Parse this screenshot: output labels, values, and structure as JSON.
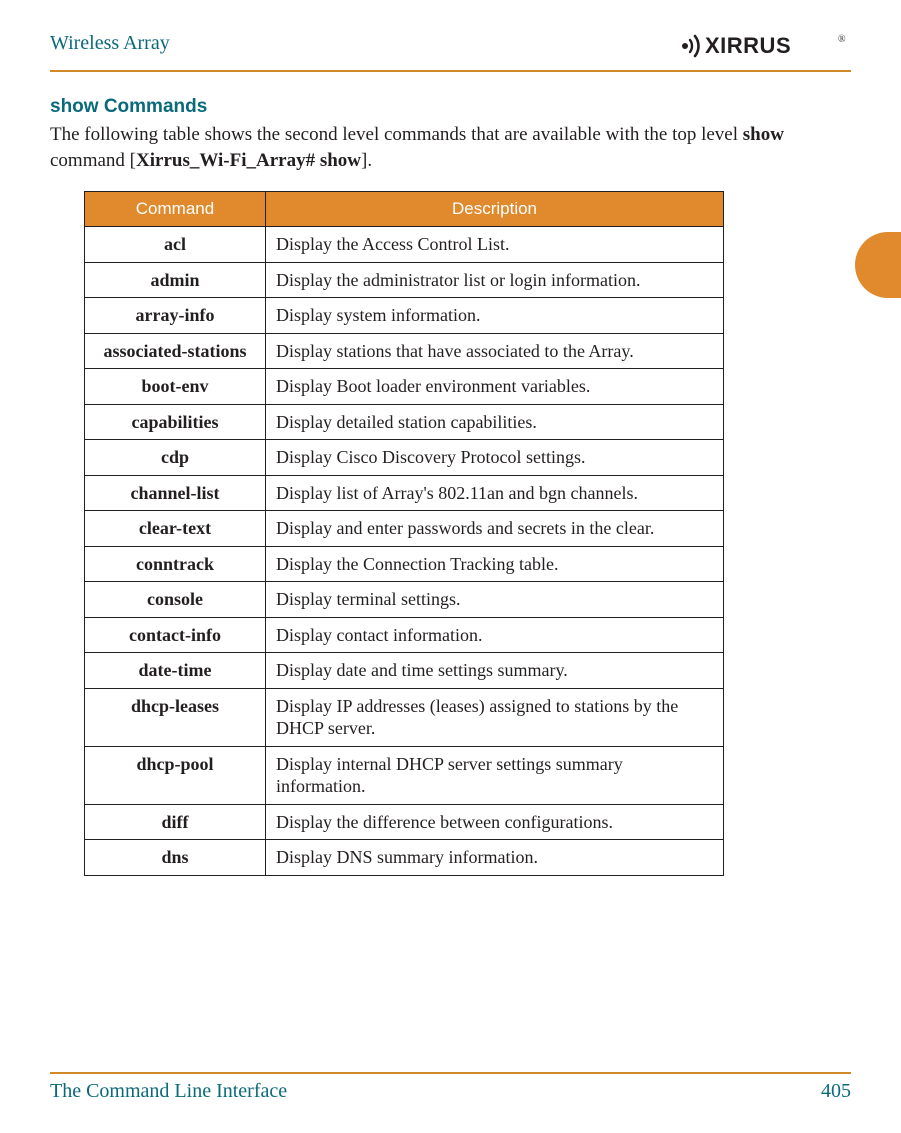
{
  "header": {
    "title": "Wireless Array",
    "logo_text": "XIRRUS"
  },
  "section_heading": "show Commands",
  "intro": {
    "prefix": "The following table shows the second level commands that are available with the top level ",
    "bold1": "show",
    "mid": " command [",
    "bold2": "Xirrus_Wi-Fi_Array# show",
    "suffix": "]."
  },
  "table": {
    "headers": {
      "command": "Command",
      "description": "Description"
    },
    "rows": [
      {
        "command": "acl",
        "description": "Display the Access Control List."
      },
      {
        "command": "admin",
        "description": "Display the administrator list or login information."
      },
      {
        "command": "array-info",
        "description": "Display system information."
      },
      {
        "command": "associated-stations",
        "description": "Display stations that have associated to the Array."
      },
      {
        "command": "boot-env",
        "description": "Display Boot loader environment variables."
      },
      {
        "command": "capabilities",
        "description": "Display detailed station capabilities."
      },
      {
        "command": "cdp",
        "description": "Display Cisco Discovery Protocol settings."
      },
      {
        "command": "channel-list",
        "description": "Display list of Array's 802.11an and bgn channels."
      },
      {
        "command": "clear-text",
        "description": "Display and enter passwords and secrets in the clear."
      },
      {
        "command": "conntrack",
        "description": "Display the Connection Tracking table."
      },
      {
        "command": "console",
        "description": "Display terminal settings."
      },
      {
        "command": "contact-info",
        "description": "Display contact information."
      },
      {
        "command": "date-time",
        "description": "Display date and time settings summary."
      },
      {
        "command": "dhcp-leases",
        "description": "Display IP addresses (leases) assigned to stations by the DHCP server."
      },
      {
        "command": "dhcp-pool",
        "description": "Display internal DHCP server settings summary information."
      },
      {
        "command": "diff",
        "description": "Display the difference between configurations."
      },
      {
        "command": "dns",
        "description": "Display DNS summary information."
      }
    ]
  },
  "footer": {
    "left": "The Command Line Interface",
    "right": "405"
  }
}
